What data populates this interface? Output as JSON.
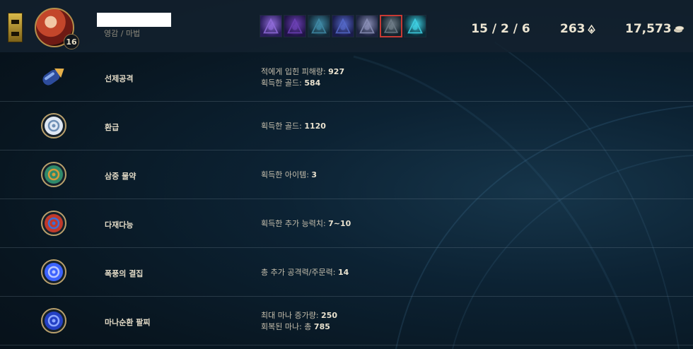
{
  "header": {
    "tree_label": "영감 / 마법",
    "level": "16",
    "items": [
      {
        "icon": "purple-blade-item-icon",
        "c1": "#2a1d5a",
        "c2": "#8f6bd8"
      },
      {
        "icon": "dark-armor-item-icon",
        "c1": "#201446",
        "c2": "#6c41b5"
      },
      {
        "icon": "crossbow-item-icon",
        "c1": "#132a38",
        "c2": "#3f8aa6"
      },
      {
        "icon": "claw-item-icon",
        "c1": "#1a1c4a",
        "c2": "#5468c8"
      },
      {
        "icon": "spear-item-icon",
        "c1": "#1d2340",
        "c2": "#8a8fb6"
      },
      {
        "icon": "ward-item-icon",
        "c1": "#14222c",
        "c2": "#6f7d88",
        "selected": true
      },
      {
        "icon": "trinket-orb-item-icon",
        "c1": "#0a2a36",
        "c2": "#3fd1e4"
      }
    ],
    "kda": "15 / 2 / 6",
    "cs": "263",
    "gold": "17,573"
  },
  "runes": [
    {
      "name": "선제공격",
      "icon": "first-strike-icon",
      "keystone": true,
      "c1": "#2d4c9c",
      "c2": "#e6b04a",
      "stats": [
        {
          "label": "적에게 입힌 피해량: ",
          "value": "927"
        },
        {
          "label": "획득한 골드: ",
          "value": "584"
        }
      ]
    },
    {
      "name": "환급",
      "icon": "cash-back-icon",
      "c1": "#dfe8f4",
      "c2": "#6f8fb5",
      "stats": [
        {
          "label": "획득한 골드: ",
          "value": "1120"
        }
      ]
    },
    {
      "name": "삼중 물약",
      "icon": "triple-tonic-icon",
      "c1": "#2f8a6b",
      "c2": "#d59a3a",
      "stats": [
        {
          "label": "획득한 아이템: ",
          "value": "3"
        }
      ]
    },
    {
      "name": "다재다능",
      "icon": "jack-of-all-trades-icon",
      "c1": "#c0392b",
      "c2": "#3b6fd6",
      "stats": [
        {
          "label": "획득한 추가 능력치: ",
          "value": "7~10"
        }
      ]
    },
    {
      "name": "폭풍의 결집",
      "icon": "gathering-storm-icon",
      "c1": "#3c63ff",
      "c2": "#b9c8ff",
      "stats": [
        {
          "label": "총 추가 공격력/주문력: ",
          "value": "14"
        }
      ]
    },
    {
      "name": "마나순환 팔찌",
      "icon": "manaflow-band-icon",
      "c1": "#2440c4",
      "c2": "#8ea8ff",
      "stats": [
        {
          "label": "최대 마나 증가량: ",
          "value": "250"
        },
        {
          "label": "회복된 마나: 총 ",
          "value": "785"
        }
      ]
    }
  ]
}
